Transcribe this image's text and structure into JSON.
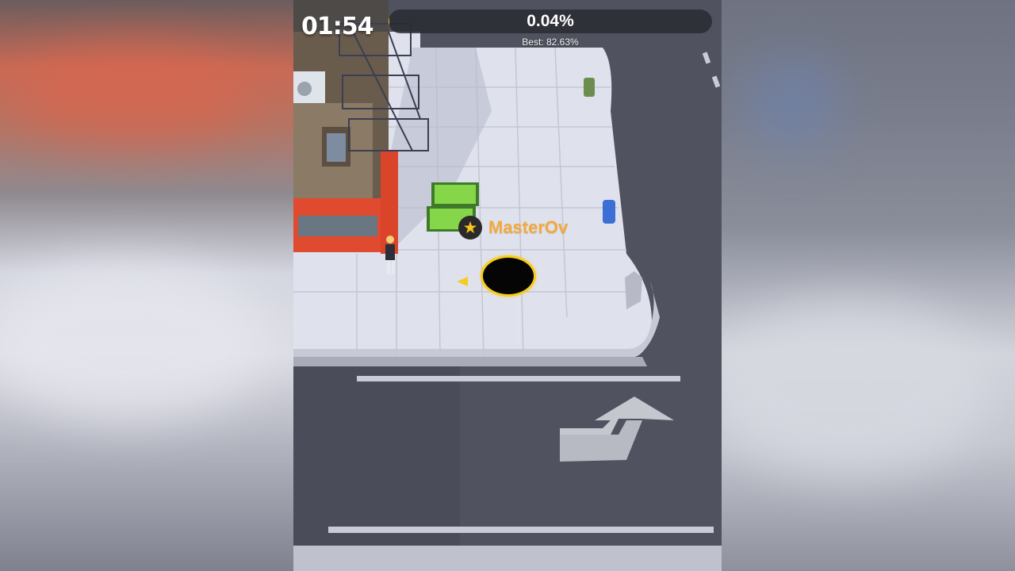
{
  "hud": {
    "timer": "01:54",
    "progress_percent": "0.04%",
    "progress_fraction": 0.0004,
    "best_label": "Best: 82.63%"
  },
  "player": {
    "name": "MasterOv",
    "badge_icon": "star-icon",
    "hole_color": "#050505",
    "ring_color": "#f6cc1e"
  },
  "colors": {
    "accent": "#f6cc1e",
    "name_color": "#f4a93a",
    "sidewalk": "#dfe2ed",
    "road": "#50535f"
  }
}
